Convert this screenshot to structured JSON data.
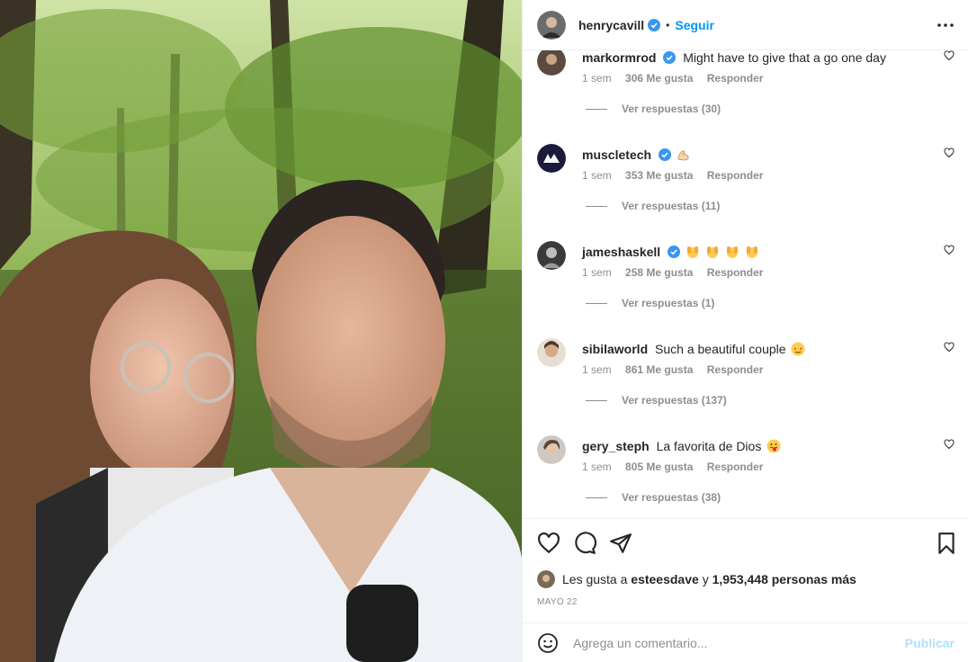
{
  "header": {
    "username": "henrycavill",
    "separator": "•",
    "follow_label": "Seguir"
  },
  "comments": [
    {
      "user": "markormrod",
      "text": "Might have to give that a go one day",
      "time": "1 sem",
      "likes": "306 Me gusta",
      "reply": "Responder",
      "replies": "Ver respuestas (30)",
      "emoji": []
    },
    {
      "user": "muscletech",
      "text": "",
      "time": "1 sem",
      "likes": "353 Me gusta",
      "reply": "Responder",
      "replies": "Ver respuestas (11)",
      "emoji": [
        "flexed-biceps"
      ]
    },
    {
      "user": "jameshaskell",
      "text": "",
      "time": "1 sem",
      "likes": "258 Me gusta",
      "reply": "Responder",
      "replies": "Ver respuestas (1)",
      "emoji": [
        "raising-hands",
        "raising-hands",
        "raising-hands",
        "raising-hands"
      ]
    },
    {
      "user": "sibilaworld",
      "text": "Such a beautiful couple",
      "time": "1 sem",
      "likes": "861 Me gusta",
      "reply": "Responder",
      "replies": "Ver respuestas (137)",
      "emoji": [
        "heart-eyes"
      ]
    },
    {
      "user": "gery_steph",
      "text": "La favorita de Dios",
      "time": "1 sem",
      "likes": "805 Me gusta",
      "reply": "Responder",
      "replies": "Ver respuestas (38)",
      "emoji": [
        "tongue-face"
      ]
    }
  ],
  "likes": {
    "prefix": "Les gusta a",
    "user": "esteesdave",
    "connector": "y",
    "others": "1,953,448 personas más"
  },
  "date": "MAYO 22",
  "add_comment": {
    "placeholder": "Agrega un comentario...",
    "publish_label": "Publicar"
  },
  "colors": {
    "accent": "#0095f6",
    "verified": "#3897f0",
    "muted": "#8e8e8e",
    "publish_disabled": "#b2dffc"
  }
}
